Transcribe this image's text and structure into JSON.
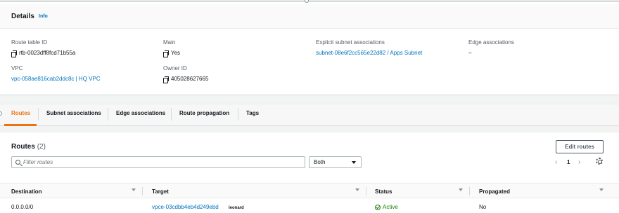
{
  "details": {
    "title": "Details",
    "info_link": "Info",
    "fields": {
      "route_table_id": {
        "label": "Route table ID",
        "value": "rtb-0023dff8fcd71b55a"
      },
      "vpc": {
        "label": "VPC",
        "value": "vpc-058ae816cab2ddc8c | HQ VPC"
      },
      "main": {
        "label": "Main",
        "value": "Yes"
      },
      "owner_id": {
        "label": "Owner ID",
        "value": "405028627665"
      },
      "explicit_subnet": {
        "label": "Explicit subnet associations",
        "value": "subnet-08e6f2cc565e22d82 / Apps Subnet"
      },
      "edge_associations": {
        "label": "Edge associations",
        "value": "–"
      }
    }
  },
  "tabs": [
    "Routes",
    "Subnet associations",
    "Edge associations",
    "Route propagation",
    "Tags"
  ],
  "active_tab": "Routes",
  "routes": {
    "title": "Routes",
    "count": "(2)",
    "edit_button": "Edit routes",
    "filter_placeholder": "Filter routes",
    "filter_select": "Both",
    "page": "1",
    "columns": [
      "Destination",
      "Target",
      "Status",
      "Propagated"
    ],
    "rows": [
      {
        "destination": "0.0.0.0/0",
        "target": "vpce-03cdbb4eb4d249ebd",
        "target_note": "leonard",
        "status": "Active",
        "propagated": "No"
      }
    ]
  },
  "colors": {
    "accent": "#ec7211",
    "link": "#0073bb",
    "success": "#1d8102"
  },
  "icons": [
    "copy-icon",
    "search-icon",
    "chevron-left-icon",
    "chevron-right-icon",
    "gear-icon",
    "status-active-icon"
  ]
}
